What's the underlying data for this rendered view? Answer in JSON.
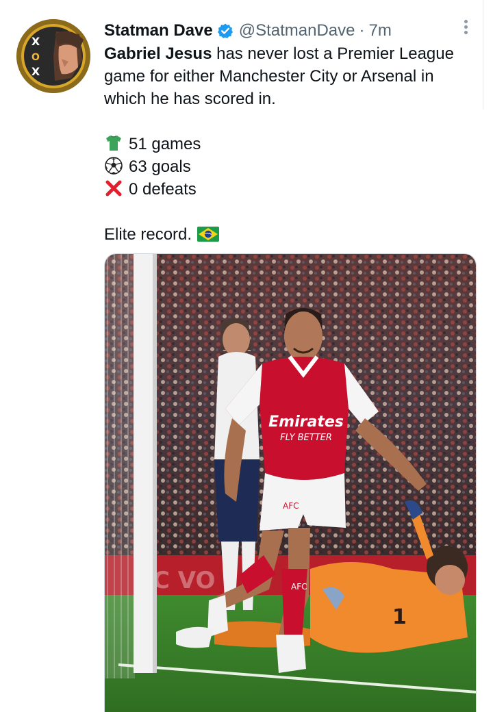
{
  "tweet": {
    "display_name": "Statman Dave",
    "handle": "@StatmanDave",
    "separator": "·",
    "time": "7m",
    "text": {
      "lead_bold": "Gabriel Jesus",
      "lead_rest": " has never lost a Premier League game for either Manchester City or Arsenal in which he has scored in.",
      "stats": [
        {
          "icon": "shirt-emoji",
          "label": "51 games"
        },
        {
          "icon": "soccer-ball-emoji",
          "label": "63 goals"
        },
        {
          "icon": "red-cross-emoji",
          "label": "0 defeats"
        }
      ],
      "closing": "Elite record.",
      "closing_icon": "brazil-flag-emoji"
    },
    "media": {
      "kind": "photo",
      "shirt_sponsor": "Emirates FLY BETTER",
      "shorts_text": "AFC",
      "keeper_number": "1"
    }
  },
  "colors": {
    "accent": "#1d9bf0",
    "text": "#0f1419",
    "secondary": "#536471",
    "arsenal_red": "#c8102e",
    "keeper_orange": "#f08a2c"
  },
  "icons": {
    "verified": "verified-badge-icon",
    "more": "more-options-icon",
    "avatar": "avatar"
  }
}
